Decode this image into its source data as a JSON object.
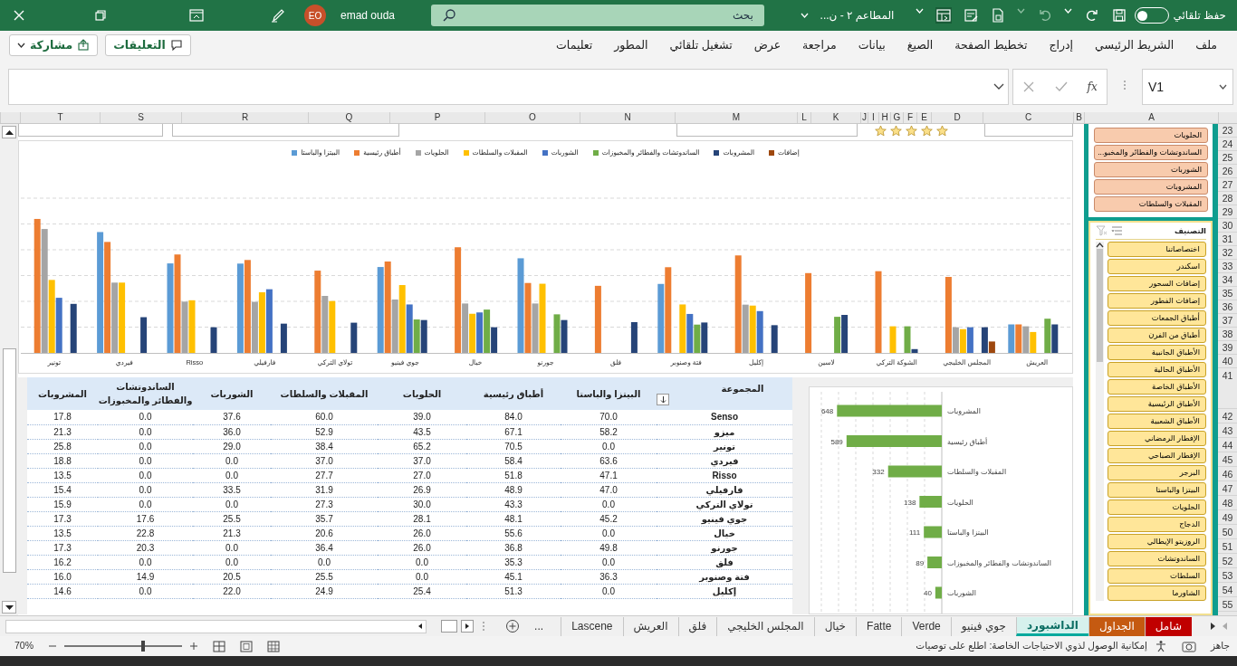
{
  "title_bar": {
    "autosave_label": "حفظ تلقائي",
    "autosave_on": false,
    "file_name": "المطاعم ٢ - ن...",
    "search_placeholder": "بحث",
    "user_name": "emad ouda",
    "user_initials": "EO"
  },
  "ribbon": {
    "tabs": [
      {
        "label": "ملف"
      },
      {
        "label": "الشريط الرئيسي"
      },
      {
        "label": "إدراج"
      },
      {
        "label": "تخطيط الصفحة"
      },
      {
        "label": "الصيغ"
      },
      {
        "label": "بيانات"
      },
      {
        "label": "مراجعة"
      },
      {
        "label": "عرض"
      },
      {
        "label": "تشغيل تلقائي"
      },
      {
        "label": "المطور"
      },
      {
        "label": "تعليمات"
      }
    ],
    "comments_button": "التعليقات",
    "share_button": "مشاركة"
  },
  "formula_bar": {
    "name_box": "V1",
    "function_label": "fx"
  },
  "columns": [
    "A",
    "B",
    "C",
    "D",
    "E",
    "F",
    "G",
    "H",
    "I",
    "J",
    "K",
    "L",
    "M",
    "N",
    "O",
    "P",
    "Q",
    "R",
    "S",
    "T"
  ],
  "rows": [
    "23",
    "24",
    "25",
    "26",
    "27",
    "28",
    "29",
    "30",
    "31",
    "32",
    "33",
    "34",
    "35",
    "36",
    "37",
    "38",
    "39",
    "40",
    "41",
    "42",
    "43",
    "44",
    "45",
    "46",
    "47",
    "48",
    "49",
    "50",
    "51",
    "52",
    "53",
    "54",
    "55"
  ],
  "rating": {
    "stars": 5
  },
  "main_chart": {
    "legend": [
      {
        "name": "إضافات",
        "color": "#9e480e"
      },
      {
        "name": "المشروبات",
        "color": "#264478"
      },
      {
        "name": "الساندوتشات والفطائر والمخبوزات",
        "color": "#70ad47"
      },
      {
        "name": "الشوربات",
        "color": "#4472c4"
      },
      {
        "name": "المقبلات والسلطات",
        "color": "#ffc000"
      },
      {
        "name": "الحلويات",
        "color": "#a5a5a5"
      },
      {
        "name": "أطباق رئيسية",
        "color": "#ed7d31"
      },
      {
        "name": "البيتزا والباستا",
        "color": "#5b9bd5"
      }
    ],
    "categories": [
      "العريش",
      "المجلس الخليجي",
      "الشوكة التركي",
      "لاسين",
      "إكليل",
      "فتة وصنوبر",
      "فلق",
      "جورنو",
      "خيال",
      "جوي فينيو",
      "تولاي التركي",
      "فارفيلي",
      "Risso",
      "فيردي",
      "تونير"
    ]
  },
  "table": {
    "columns": [
      "المجموعة",
      "البيتزا والباستا",
      "أطباق رئيسية",
      "الحلويات",
      "المقبلات والسلطات",
      "الشوربات",
      "الساندوتشات والفطائر والمخبوزات",
      "المشروبات"
    ],
    "rows": [
      [
        "Senso",
        "70.0",
        "84.0",
        "39.0",
        "60.0",
        "37.6",
        "0.0",
        "17.8"
      ],
      [
        "ميزو",
        "58.2",
        "67.1",
        "43.5",
        "52.9",
        "36.0",
        "0.0",
        "21.3"
      ],
      [
        "تونير",
        "0.0",
        "70.5",
        "65.2",
        "38.4",
        "29.0",
        "0.0",
        "25.8"
      ],
      [
        "فيردي",
        "63.6",
        "58.4",
        "37.0",
        "37.0",
        "0.0",
        "0.0",
        "18.8"
      ],
      [
        "Risso",
        "47.1",
        "51.8",
        "27.0",
        "27.7",
        "0.0",
        "0.0",
        "13.5"
      ],
      [
        "فارفيلي",
        "47.0",
        "48.9",
        "26.9",
        "31.9",
        "33.5",
        "0.0",
        "15.4"
      ],
      [
        "تولاي التركي",
        "0.0",
        "43.3",
        "30.0",
        "27.3",
        "0.0",
        "0.0",
        "15.9"
      ],
      [
        "جوي فينيو",
        "45.2",
        "48.1",
        "28.1",
        "35.7",
        "25.5",
        "17.6",
        "17.3"
      ],
      [
        "خيال",
        "0.0",
        "55.6",
        "26.0",
        "20.6",
        "21.3",
        "22.8",
        "13.5"
      ],
      [
        "جورنو",
        "49.8",
        "36.8",
        "26.0",
        "36.4",
        "0.0",
        "20.3",
        "17.3"
      ],
      [
        "فلق",
        "0.0",
        "35.3",
        "0.0",
        "0.0",
        "0.0",
        "0.0",
        "16.2"
      ],
      [
        "فتة وصنوبر",
        "36.3",
        "45.1",
        "0.0",
        "25.5",
        "20.5",
        "14.9",
        "16.0"
      ],
      [
        "إكليل",
        "0.0",
        "51.3",
        "25.4",
        "24.9",
        "22.0",
        "0.0",
        "14.6"
      ]
    ]
  },
  "side_chart": {
    "chart_data": {
      "type": "bar",
      "orientation": "horizontal",
      "categories": [
        "المشروبات",
        "أطباق رئيسية",
        "المقبلات والسلطات",
        "الحلويات",
        "البيتزا والباستا",
        "الساندوتشات والفطائر والمخبوزات",
        "الشوربات"
      ],
      "series": [
        {
          "color": "#70ad47",
          "values": [
            648,
            589,
            332,
            138,
            111,
            89,
            40
          ]
        }
      ],
      "data_labels": true
    }
  },
  "slicers": [
    {
      "items": [
        {
          "label": "الحلويات",
          "selected": true
        },
        {
          "label": "الساندوتشات والفطائر والمخبو...",
          "selected": true
        },
        {
          "label": "الشوربات",
          "selected": true
        },
        {
          "label": "المشروبات",
          "selected": true
        },
        {
          "label": "المقبلات والسلطات",
          "selected": true
        }
      ]
    },
    {
      "title": "التصنيف",
      "items": [
        {
          "label": "اختصاصاتنا",
          "selected": true
        },
        {
          "label": "اسكندر",
          "selected": true
        },
        {
          "label": "إضافات السحور",
          "selected": true
        },
        {
          "label": "إضافات الفطور",
          "selected": true
        },
        {
          "label": "أطباق الجمعات",
          "selected": true
        },
        {
          "label": "أطباق من الفرن",
          "selected": true
        },
        {
          "label": "الأطباق الجانبية",
          "selected": true
        },
        {
          "label": "الأطباق الحالية",
          "selected": true
        },
        {
          "label": "الأطباق الخاصة",
          "selected": true
        },
        {
          "label": "الأطباق الرئيسية",
          "selected": true
        },
        {
          "label": "الأطباق الشعبية",
          "selected": true
        },
        {
          "label": "الإفطار الرمضاني",
          "selected": true
        },
        {
          "label": "الإفطار الصباحي",
          "selected": true
        },
        {
          "label": "البرجر",
          "selected": true
        },
        {
          "label": "البيتزا والباستا",
          "selected": true
        },
        {
          "label": "الحلويات",
          "selected": true
        },
        {
          "label": "الدجاج",
          "selected": true
        },
        {
          "label": "الروزيتو الإيطالي",
          "selected": true
        },
        {
          "label": "الساندوتشات",
          "selected": true
        },
        {
          "label": "السلطات",
          "selected": true
        },
        {
          "label": "الشاورما",
          "selected": true
        }
      ]
    }
  ],
  "sheet_tabs": [
    {
      "label": "شامل",
      "selected": false,
      "color": "#c00000"
    },
    {
      "label": "الجداول",
      "selected": false,
      "color": "#c55a11"
    },
    {
      "label": "الداشبورد",
      "selected": true,
      "color": "#00a99d"
    },
    {
      "label": "جوي فينيو",
      "selected": false
    },
    {
      "label": "Verde",
      "selected": false
    },
    {
      "label": "Fatte",
      "selected": false
    },
    {
      "label": "خيال",
      "selected": false
    },
    {
      "label": "المجلس الخليجي",
      "selected": false
    },
    {
      "label": "فلق",
      "selected": false
    },
    {
      "label": "العريش",
      "selected": false
    },
    {
      "label": "Lascene",
      "selected": false
    }
  ],
  "more_tabs": "...",
  "status_bar": {
    "mode": "جاهز",
    "accessibility": "إمكانية الوصول لذوي الاحتياجات الخاصة: اطلع على توصيات",
    "zoom": "70%",
    "zoom_slider": {
      "level": 0.67
    }
  }
}
